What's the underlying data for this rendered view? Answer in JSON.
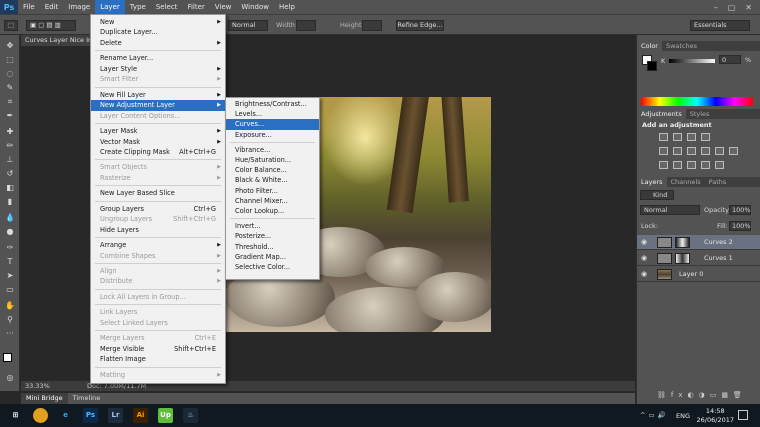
{
  "app": {
    "logo": "Ps"
  },
  "menubar": {
    "items": [
      "File",
      "Edit",
      "Image",
      "Layer",
      "Type",
      "Select",
      "Filter",
      "View",
      "Window",
      "Help"
    ],
    "active": "Layer",
    "window_controls": [
      "–",
      "▢",
      "✕"
    ]
  },
  "options_bar": {
    "blend_mode": "Normal",
    "width_label": "Width:",
    "height_label": "Height:",
    "refine_edge": "Refine Edge...",
    "workspace": "Essentials"
  },
  "document": {
    "tab_title": "Curves Layer Nice Im",
    "zoom": "33.33%",
    "doc_info": "Doc: 7.00M/11.7M"
  },
  "bottom_tabs": [
    "Mini Bridge",
    "Timeline"
  ],
  "layer_menu": {
    "items": [
      {
        "label": "New",
        "arrow": true
      },
      {
        "label": "Duplicate Layer..."
      },
      {
        "label": "Delete",
        "arrow": true
      },
      {
        "sep": true
      },
      {
        "label": "Rename Layer..."
      },
      {
        "label": "Layer Style",
        "arrow": true
      },
      {
        "label": "Smart Filter",
        "disabled": true,
        "arrow": true
      },
      {
        "sep": true
      },
      {
        "label": "New Fill Layer",
        "arrow": true
      },
      {
        "label": "New Adjustment Layer",
        "arrow": true,
        "highlight": true
      },
      {
        "label": "Layer Content Options...",
        "disabled": true
      },
      {
        "sep": true
      },
      {
        "label": "Layer Mask",
        "arrow": true
      },
      {
        "label": "Vector Mask",
        "arrow": true
      },
      {
        "label": "Create Clipping Mask",
        "shortcut": "Alt+Ctrl+G"
      },
      {
        "sep": true
      },
      {
        "label": "Smart Objects",
        "disabled": true,
        "arrow": true
      },
      {
        "label": "Rasterize",
        "disabled": true,
        "arrow": true
      },
      {
        "sep": true
      },
      {
        "label": "New Layer Based Slice"
      },
      {
        "sep": true
      },
      {
        "label": "Group Layers",
        "shortcut": "Ctrl+G"
      },
      {
        "label": "Ungroup Layers",
        "shortcut": "Shift+Ctrl+G",
        "disabled": true
      },
      {
        "label": "Hide Layers"
      },
      {
        "sep": true
      },
      {
        "label": "Arrange",
        "arrow": true
      },
      {
        "label": "Combine Shapes",
        "disabled": true,
        "arrow": true
      },
      {
        "sep": true
      },
      {
        "label": "Align",
        "disabled": true,
        "arrow": true
      },
      {
        "label": "Distribute",
        "disabled": true,
        "arrow": true
      },
      {
        "sep": true
      },
      {
        "label": "Lock All Layers in Group...",
        "disabled": true
      },
      {
        "sep": true
      },
      {
        "label": "Link Layers",
        "disabled": true
      },
      {
        "label": "Select Linked Layers",
        "disabled": true
      },
      {
        "sep": true
      },
      {
        "label": "Merge Layers",
        "shortcut": "Ctrl+E",
        "disabled": true
      },
      {
        "label": "Merge Visible",
        "shortcut": "Shift+Ctrl+E"
      },
      {
        "label": "Flatten Image"
      },
      {
        "sep": true
      },
      {
        "label": "Matting",
        "disabled": true,
        "arrow": true
      }
    ]
  },
  "adjustment_submenu": {
    "items": [
      {
        "label": "Brightness/Contrast..."
      },
      {
        "label": "Levels..."
      },
      {
        "label": "Curves...",
        "highlight": true
      },
      {
        "label": "Exposure..."
      },
      {
        "sep": true
      },
      {
        "label": "Vibrance..."
      },
      {
        "label": "Hue/Saturation..."
      },
      {
        "label": "Color Balance..."
      },
      {
        "label": "Black & White..."
      },
      {
        "label": "Photo Filter..."
      },
      {
        "label": "Channel Mixer..."
      },
      {
        "label": "Color Lookup..."
      },
      {
        "sep": true
      },
      {
        "label": "Invert..."
      },
      {
        "label": "Posterize..."
      },
      {
        "label": "Threshold..."
      },
      {
        "label": "Gradient Map..."
      },
      {
        "label": "Selective Color..."
      }
    ]
  },
  "panels": {
    "color_tabs": [
      "Color",
      "Swatches"
    ],
    "color_channel": "K",
    "color_value": "0",
    "color_unit": "%",
    "adjust_tabs": [
      "Adjustments",
      "Styles"
    ],
    "adjust_title": "Add an adjustment",
    "layers_tabs": [
      "Layers",
      "Channels",
      "Paths"
    ],
    "kind_label": "Kind",
    "blend_mode": "Normal",
    "opacity_label": "Opacity:",
    "opacity_value": "100%",
    "lock_label": "Lock:",
    "fill_label": "Fill:",
    "fill_value": "100%",
    "layers": [
      {
        "name": "Curves 2",
        "selected": true
      },
      {
        "name": "Curves 1",
        "selected": false
      },
      {
        "name": "Layer 0",
        "selected": false
      }
    ]
  },
  "taskbar": {
    "apps": [
      {
        "name": "windows-icon",
        "label": "⊞",
        "color": "#ffffff",
        "bg": "#101820"
      },
      {
        "name": "chrome-icon",
        "label": "",
        "color": "#ffffff",
        "bg": "#e0a020"
      },
      {
        "name": "ie-icon",
        "label": "e",
        "color": "#2aa5f5",
        "bg": "#101820"
      },
      {
        "name": "photoshop-icon",
        "label": "Ps",
        "color": "#4fb8ff",
        "bg": "#0b2a4a"
      },
      {
        "name": "lightroom-icon",
        "label": "Lr",
        "color": "#a9c6e8",
        "bg": "#1c2c3c"
      },
      {
        "name": "illustrator-icon",
        "label": "Ai",
        "color": "#ff9a00",
        "bg": "#3a2100"
      },
      {
        "name": "upwork-icon",
        "label": "Up",
        "color": "#ffffff",
        "bg": "#5fbf3a"
      },
      {
        "name": "steam-icon",
        "label": "♨",
        "color": "#c7d5e0",
        "bg": "#1b2838"
      }
    ],
    "tray_lang": "ENG",
    "time": "14:58",
    "date": "26/06/2017"
  }
}
